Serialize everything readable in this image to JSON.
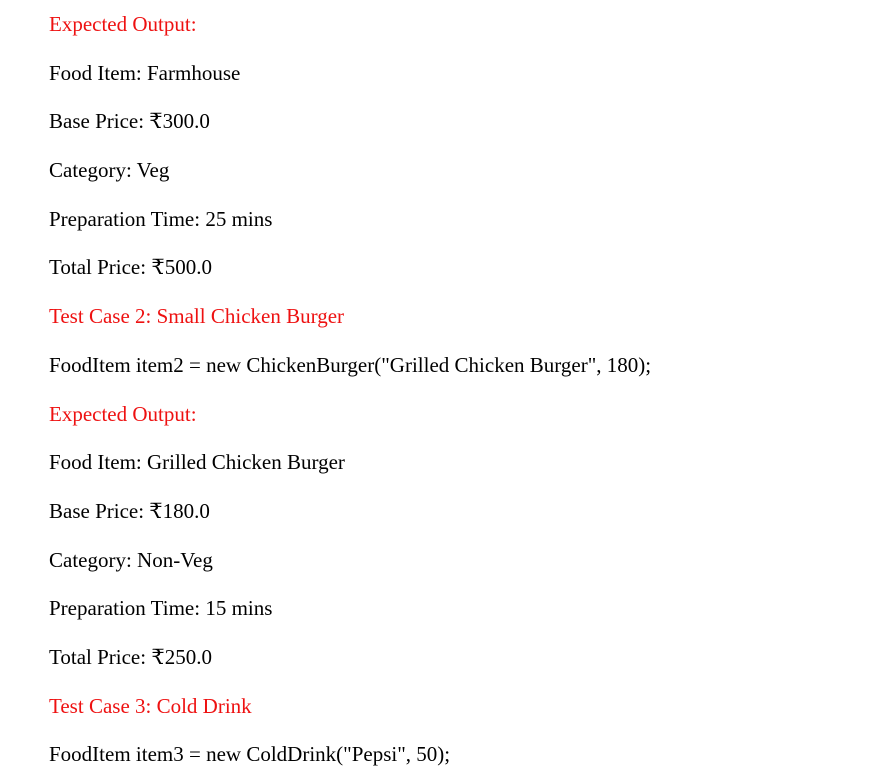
{
  "lines": [
    {
      "text": "Expected Output:",
      "style": "heading"
    },
    {
      "text": "Food Item: Farmhouse",
      "style": "normal"
    },
    {
      "text": "Base Price: ₹300.0",
      "style": "normal"
    },
    {
      "text": "Category: Veg",
      "style": "normal"
    },
    {
      "text": "Preparation Time: 25 mins",
      "style": "normal"
    },
    {
      "text": "Total Price: ₹500.0",
      "style": "normal"
    },
    {
      "text": "Test Case 2: Small Chicken Burger",
      "style": "heading"
    },
    {
      "text": "FoodItem item2 = new ChickenBurger(\"Grilled Chicken Burger\", 180);",
      "style": "normal"
    },
    {
      "text": "Expected Output:",
      "style": "heading"
    },
    {
      "text": "Food Item: Grilled Chicken Burger",
      "style": "normal"
    },
    {
      "text": "Base Price: ₹180.0",
      "style": "normal"
    },
    {
      "text": "Category: Non-Veg",
      "style": "normal"
    },
    {
      "text": "Preparation Time: 15 mins",
      "style": "normal"
    },
    {
      "text": "Total Price: ₹250.0",
      "style": "normal"
    },
    {
      "text": "Test Case 3: Cold Drink",
      "style": "heading"
    },
    {
      "text": "FoodItem item3 = new ColdDrink(\"Pepsi\", 50);",
      "style": "normal"
    }
  ],
  "colors": {
    "heading": "#ee1111",
    "text": "#000000"
  }
}
